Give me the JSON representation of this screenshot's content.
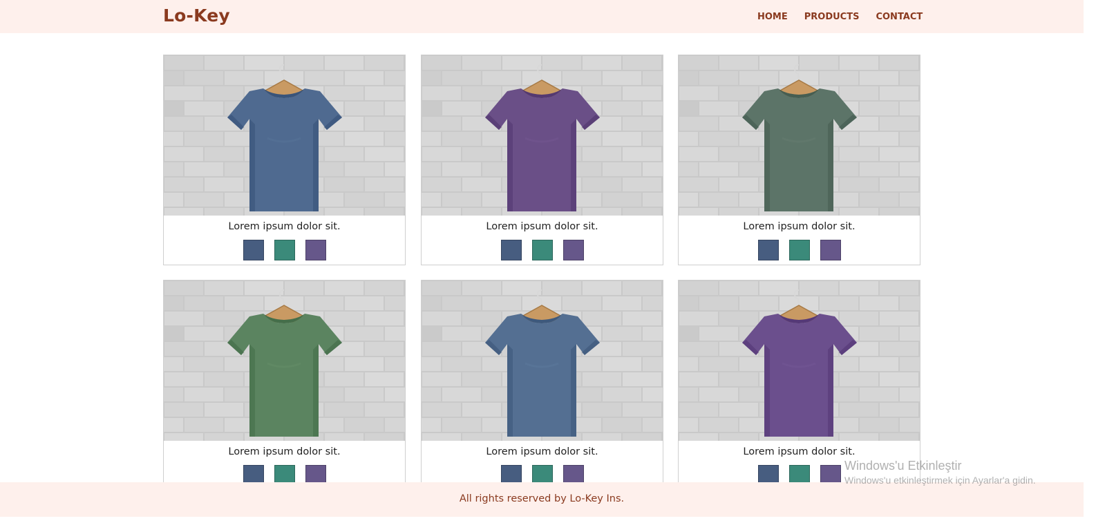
{
  "header": {
    "brand": "Lo-Key",
    "nav": [
      "HOME",
      "PRODUCTS",
      "CONTACT"
    ]
  },
  "products": [
    {
      "title": "Lorem ipsum dolor sit.",
      "shirt_color": "#4f6a90"
    },
    {
      "title": "Lorem ipsum dolor sit.",
      "shirt_color": "#6a4f87"
    },
    {
      "title": "Lorem ipsum dolor sit.",
      "shirt_color": "#5c7468"
    },
    {
      "title": "Lorem ipsum dolor sit.",
      "shirt_color": "#5b8460"
    },
    {
      "title": "Lorem ipsum dolor sit.",
      "shirt_color": "#546f92"
    },
    {
      "title": "Lorem ipsum dolor sit.",
      "shirt_color": "#6b4f8d"
    }
  ],
  "swatch_colors": [
    "#475d80",
    "#3b8a7a",
    "#66578a"
  ],
  "footer": {
    "text": "All rights reserved by Lo-Key Ins."
  },
  "watermark": {
    "title": "Windows'u Etkinleştir",
    "subtitle": "Windows'u etkinleştirmek için Ayarlar'a gidin."
  },
  "colors": {
    "header_bg": "#fef0ec",
    "brand": "#8a3a1f",
    "card_border": "#cfcfcf"
  }
}
